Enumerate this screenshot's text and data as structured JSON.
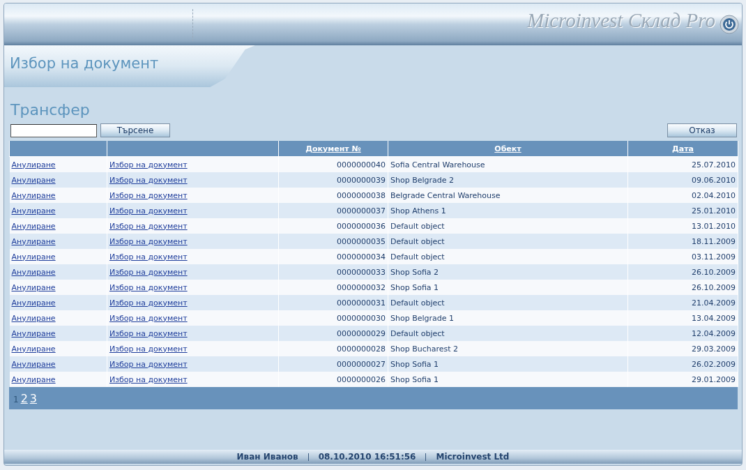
{
  "header": {
    "app_title": "Microinvest Склад Pro"
  },
  "tab": {
    "label": "Избор на документ"
  },
  "page_title": "Трансфер",
  "search": {
    "button": "Търсене"
  },
  "cancel_button": "Отказ",
  "table": {
    "columns": [
      null,
      null,
      "Документ №",
      "Обект",
      "Дата"
    ],
    "rows": [
      {
        "cancel": "Анулиране",
        "select": "Избор на документ",
        "number": "0000000040",
        "object": "Sofia Central Warehouse",
        "date": "25.07.2010"
      },
      {
        "cancel": "Анулиране",
        "select": "Избор на документ",
        "number": "0000000039",
        "object": "Shop Belgrade 2",
        "date": "09.06.2010"
      },
      {
        "cancel": "Анулиране",
        "select": "Избор на документ",
        "number": "0000000038",
        "object": "Belgrade Central Warehouse",
        "date": "02.04.2010"
      },
      {
        "cancel": "Анулиране",
        "select": "Избор на документ",
        "number": "0000000037",
        "object": "Shop Athens 1",
        "date": "25.01.2010"
      },
      {
        "cancel": "Анулиране",
        "select": "Избор на документ",
        "number": "0000000036",
        "object": "Default object",
        "date": "13.01.2010"
      },
      {
        "cancel": "Анулиране",
        "select": "Избор на документ",
        "number": "0000000035",
        "object": "Default object",
        "date": "18.11.2009"
      },
      {
        "cancel": "Анулиране",
        "select": "Избор на документ",
        "number": "0000000034",
        "object": "Default object",
        "date": "03.11.2009"
      },
      {
        "cancel": "Анулиране",
        "select": "Избор на документ",
        "number": "0000000033",
        "object": "Shop Sofia 2",
        "date": "26.10.2009"
      },
      {
        "cancel": "Анулиране",
        "select": "Избор на документ",
        "number": "0000000032",
        "object": "Shop Sofia 1",
        "date": "26.10.2009"
      },
      {
        "cancel": "Анулиране",
        "select": "Избор на документ",
        "number": "0000000031",
        "object": "Default object",
        "date": "21.04.2009"
      },
      {
        "cancel": "Анулиране",
        "select": "Избор на документ",
        "number": "0000000030",
        "object": "Shop Belgrade 1",
        "date": "13.04.2009"
      },
      {
        "cancel": "Анулиране",
        "select": "Избор на документ",
        "number": "0000000029",
        "object": "Default object",
        "date": "12.04.2009"
      },
      {
        "cancel": "Анулиране",
        "select": "Избор на документ",
        "number": "0000000028",
        "object": "Shop Bucharest 2",
        "date": "29.03.2009"
      },
      {
        "cancel": "Анулиране",
        "select": "Избор на документ",
        "number": "0000000027",
        "object": "Shop Sofia 1",
        "date": "26.02.2009"
      },
      {
        "cancel": "Анулиране",
        "select": "Избор на документ",
        "number": "0000000026",
        "object": "Shop Sofia 1",
        "date": "29.01.2009"
      }
    ]
  },
  "pager": [
    {
      "label": "1",
      "selected": true
    },
    {
      "label": "2",
      "selected": false
    },
    {
      "label": "3",
      "selected": false
    }
  ],
  "status_bar": [
    "Иван Иванов",
    "08.10.2010 16:51:56",
    "Microinvest Ltd"
  ]
}
